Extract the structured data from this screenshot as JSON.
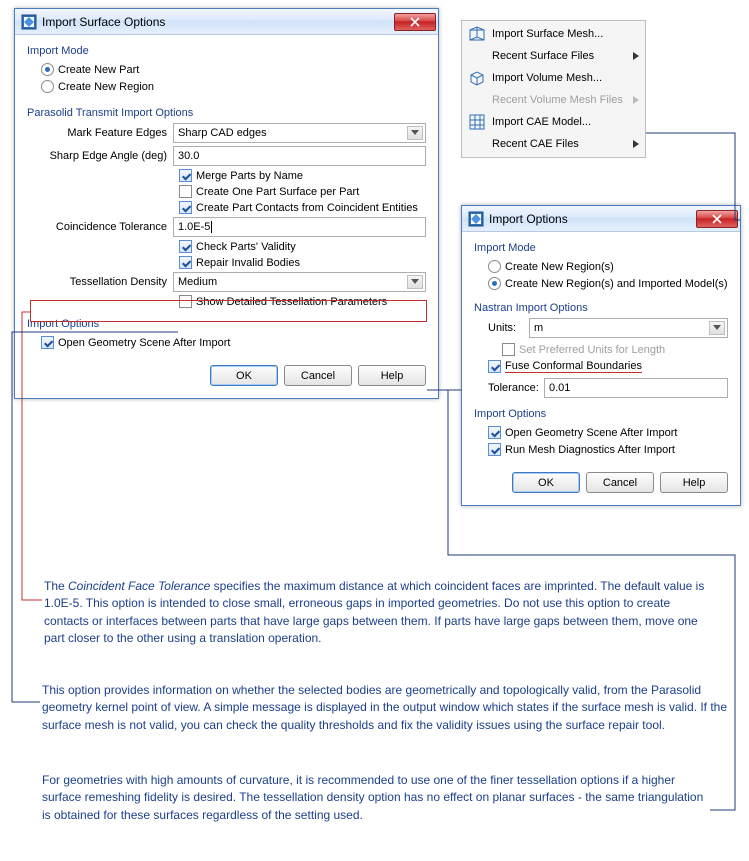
{
  "dialog1": {
    "title": "Import Surface Options",
    "importMode": {
      "label": "Import Mode",
      "opt1": "Create New Part",
      "opt2": "Create New Region"
    },
    "parasolid": {
      "sectionLabel": "Parasolid Transmit Import Options",
      "markFeatureEdgesLabel": "Mark Feature Edges",
      "markFeatureEdgesValue": "Sharp CAD edges",
      "sharpEdgeAngleLabel": "Sharp Edge Angle (deg)",
      "sharpEdgeAngleValue": "30.0",
      "mergeParts": "Merge Parts by Name",
      "createOneSurface": "Create One Part Surface per Part",
      "createContacts": "Create Part Contacts from Coincident Entities",
      "coincidenceToleranceLabel": "Coincidence Tolerance",
      "coincidenceToleranceValue": "1.0E-5",
      "checkValidity": "Check Parts' Validity",
      "repairInvalid": "Repair Invalid Bodies",
      "tessellationLabel": "Tessellation Density",
      "tessellationValue": "Medium",
      "showDetailed": "Show Detailed Tessellation Parameters"
    },
    "importOptions": {
      "label": "Import Options",
      "openGeom": "Open Geometry Scene After Import"
    },
    "buttons": {
      "ok": "OK",
      "cancel": "Cancel",
      "help": "Help"
    }
  },
  "menu": {
    "item1": "Import Surface Mesh...",
    "item2": "Recent Surface Files",
    "item3": "Import Volume Mesh...",
    "item4": "Recent Volume Mesh Files",
    "item5": "Import CAE Model...",
    "item6": "Recent CAE Files"
  },
  "dialog2": {
    "title": "Import Options",
    "importMode": {
      "label": "Import Mode",
      "opt1": "Create New Region(s)",
      "opt2": "Create New Region(s) and Imported Model(s)"
    },
    "nastran": {
      "label": "Nastran Import Options",
      "unitsLabel": "Units:",
      "unitsValue": "m",
      "setPreferred": "Set Preferred Units for Length",
      "fuseConformal": "Fuse Conformal Boundaries",
      "toleranceLabel": "Tolerance:",
      "toleranceValue": "0.01"
    },
    "importOptions": {
      "label": "Import Options",
      "openGeom": "Open Geometry Scene After Import",
      "runDiag": "Run Mesh Diagnostics After Import"
    },
    "buttons": {
      "ok": "OK",
      "cancel": "Cancel",
      "help": "Help"
    }
  },
  "text": {
    "para1_a": "The ",
    "para1_em": "Coincident Face Tolerance",
    "para1_b": " specifies the maximum distance at which coincident faces are imprinted. The default value is 1.0E-5. This option is intended to close small, erroneous gaps in imported geometries. Do not use this option to create contacts or interfaces between parts that have large gaps between them. If parts have large gaps between them, move one part closer to the other using a translation operation.",
    "para2": "This option provides information on whether the selected bodies are geometrically and topologically valid, from the Parasolid geometry kernel point of view. A simple message is displayed in the output window which states if the surface mesh is valid. If the surface mesh is not valid, you can check the quality thresholds and fix the validity issues using the surface repair tool.",
    "para3": "For geometries with high amounts of curvature, it is recommended to use one of the finer tessellation options if a higher surface remeshing fidelity is desired. The tessellation density option has no effect on planar surfaces - the same triangulation is obtained for these surfaces regardless of the setting used."
  }
}
